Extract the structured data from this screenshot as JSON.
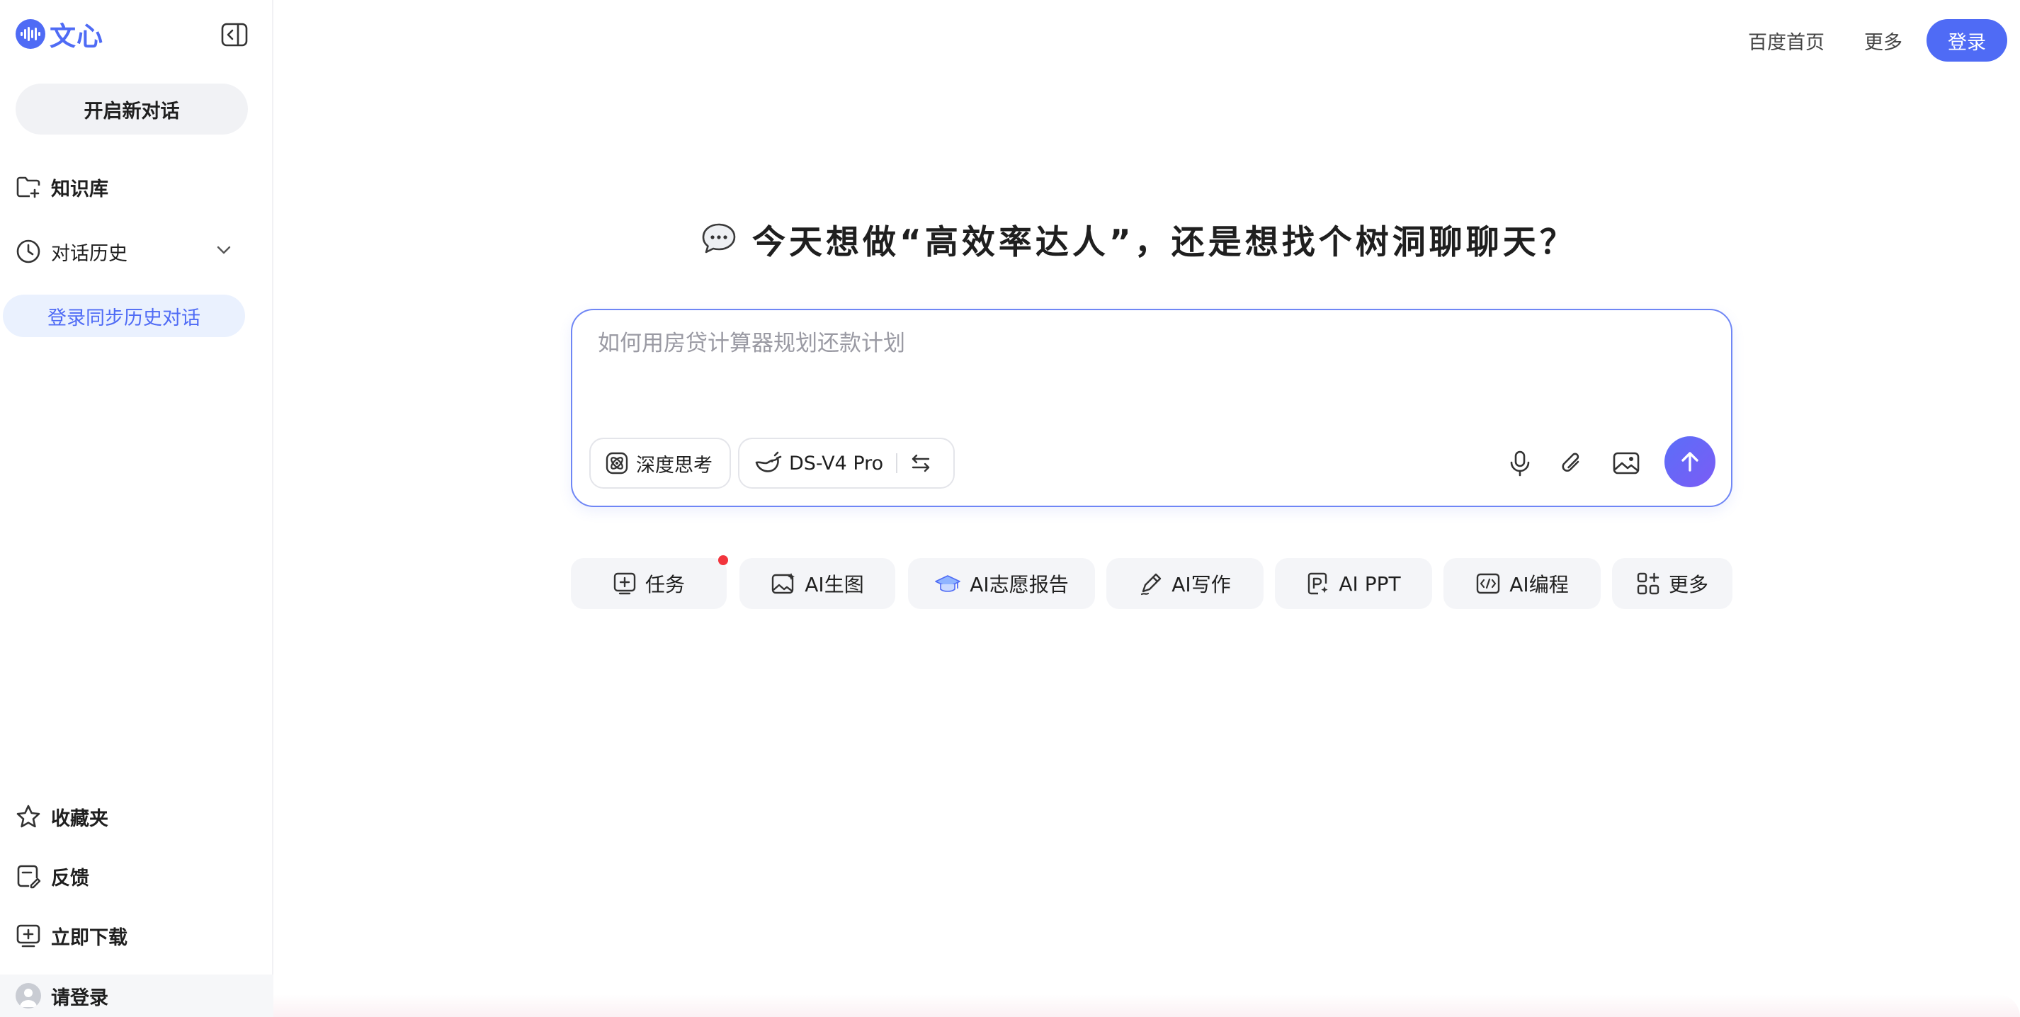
{
  "app": {
    "logo_text": "文心",
    "brand_color": "#4f6bf5"
  },
  "sidebar": {
    "new_chat_label": "开启新对话",
    "knowledge_label": "知识库",
    "history_label": "对话历史",
    "sync_history_label": "登录同步历史对话",
    "favorites_label": "收藏夹",
    "feedback_label": "反馈",
    "download_label": "立即下载",
    "login_label": "请登录"
  },
  "topbar": {
    "baidu_home": "百度首页",
    "more": "更多",
    "login": "登录"
  },
  "main": {
    "headline": "今天想做“高效率达人”，还是想找个树洞聊聊天？",
    "composer": {
      "placeholder": "如何用房贷计算器规划还款计划",
      "deep_think_label": "深度思考",
      "model_label": "DS-V4 Pro"
    },
    "actions": [
      {
        "label": "任务",
        "icon": "task-icon"
      },
      {
        "label": "AI生图",
        "icon": "image-gen-icon"
      },
      {
        "label": "AI志愿报告",
        "icon": "graduation-cap-icon"
      },
      {
        "label": "AI写作",
        "icon": "pen-icon"
      },
      {
        "label": "AI PPT",
        "icon": "ppt-icon"
      },
      {
        "label": "AI编程",
        "icon": "code-icon"
      },
      {
        "label": "更多",
        "icon": "grid-icon"
      }
    ]
  }
}
